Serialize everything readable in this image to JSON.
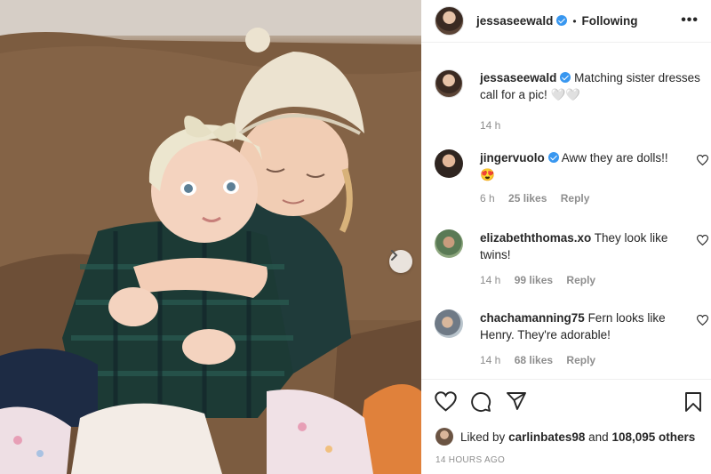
{
  "post": {
    "author": "jessaseewald",
    "follow_status": "Following",
    "dot": "•",
    "more_label": "•••"
  },
  "caption": {
    "username": "jessaseewald",
    "text": "Matching sister dresses call for a pic!",
    "hearts": "🤍🤍",
    "time": "14 h"
  },
  "comments": [
    {
      "username": "jingervuolo",
      "verified": true,
      "text": "Aww they are dolls!!",
      "extra": "😍",
      "time": "6 h",
      "likes": "25 likes",
      "reply": "Reply"
    },
    {
      "username": "elizabeththomas.xo",
      "verified": false,
      "text": "They look like twins!",
      "time": "14 h",
      "likes": "99 likes",
      "reply": "Reply"
    },
    {
      "username": "chachamanning75",
      "verified": false,
      "text": "Fern looks like Henry. They're adorable!",
      "time": "14 h",
      "likes": "68 likes",
      "reply": "Reply"
    }
  ],
  "likes_line": {
    "prefix": "Liked by",
    "user": "carlinbates98",
    "and": "and",
    "count": "108,095 others"
  },
  "timestamp": "14 HOURS AGO",
  "icons": {
    "verified": "verified-badge-icon",
    "like": "heart-icon",
    "comment": "comment-bubble-icon",
    "share": "paper-plane-icon",
    "save": "bookmark-icon",
    "next": "chevron-right-icon",
    "more": "ellipsis-icon"
  },
  "colors": {
    "verified_blue": "#3897f0",
    "secondary_text": "#8e8e8e",
    "primary_text": "#262626"
  }
}
